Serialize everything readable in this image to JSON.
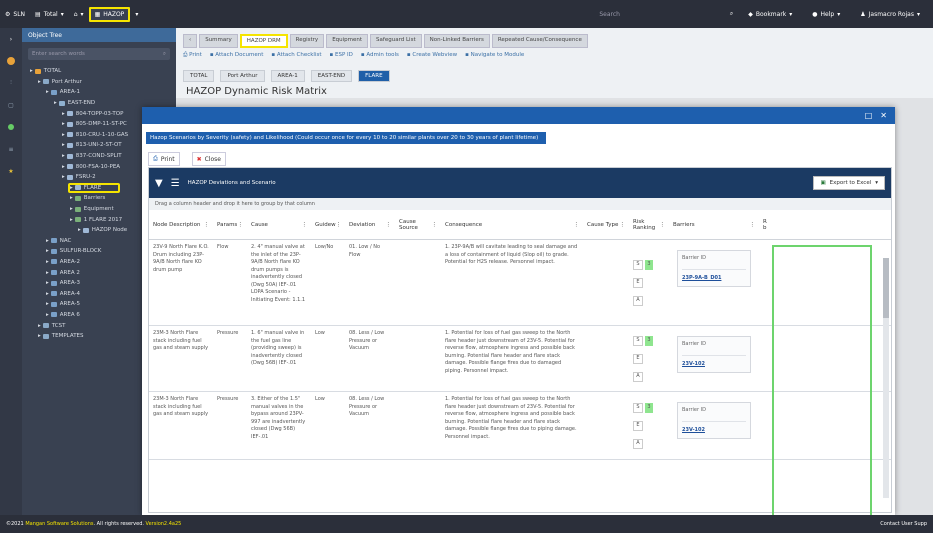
{
  "topnav": {
    "sln": "SLN",
    "total": "Total",
    "hazop": "HAZOP",
    "search": "Search",
    "bookmark": "Bookmark",
    "help": "Help",
    "user": "Jasmacro Rojas"
  },
  "tree": {
    "title": "Object Tree",
    "search_placeholder": "Enter search words",
    "nodes": [
      {
        "label": "TOTAL",
        "indent": 1
      },
      {
        "label": "Port Arthur",
        "indent": 2
      },
      {
        "label": "AREA-1",
        "indent": 3
      },
      {
        "label": "EAST-END",
        "indent": 4
      },
      {
        "label": "804-TOPP-03-TOP",
        "indent": 5
      },
      {
        "label": "805-DMP-11-ST-PC",
        "indent": 5
      },
      {
        "label": "810-CRU-1-10-GAS",
        "indent": 5
      },
      {
        "label": "813-UNI-2-ST-OT",
        "indent": 5
      },
      {
        "label": "837-COND-SPLIT",
        "indent": 5
      },
      {
        "label": "800-FSA-10-PEA",
        "indent": 5
      },
      {
        "label": "FSRU-2",
        "indent": 5
      },
      {
        "label": "FLARE",
        "indent": 5,
        "highlight": true
      },
      {
        "label": "Barriers",
        "indent": 6
      },
      {
        "label": "Equipment",
        "indent": 6
      },
      {
        "label": "1 FLARE 2017",
        "indent": 6
      },
      {
        "label": "HAZOP Node",
        "indent": 7
      },
      {
        "label": "NAC",
        "indent": 3
      },
      {
        "label": "SULFUR-BLOCK",
        "indent": 3
      },
      {
        "label": "AREA-2",
        "indent": 3
      },
      {
        "label": "AREA 2",
        "indent": 3
      },
      {
        "label": "AREA-3",
        "indent": 3
      },
      {
        "label": "AREA-4",
        "indent": 3
      },
      {
        "label": "AREA-5",
        "indent": 3
      },
      {
        "label": "AREA 6",
        "indent": 3
      },
      {
        "label": "TCST",
        "indent": 2
      },
      {
        "label": "TEMPLATES",
        "indent": 2
      }
    ]
  },
  "tabs": [
    "Summary",
    "HAZOP DRM",
    "Registry",
    "Equipment",
    "Safeguard List",
    "Non-Linked Barriers",
    "Repeated Cause/Consequence"
  ],
  "active_tab": "HAZOP DRM",
  "toolbar": [
    "Print",
    "Attach Document",
    "Attach Checklist",
    "ESP ID",
    "Admin tools",
    "Create Webview",
    "Navigate to Module"
  ],
  "breadcrumb": [
    "TOTAL",
    "Port Arthur",
    "AREA-1",
    "EAST-END",
    "FLARE"
  ],
  "page_title": "HAZOP Dynamic Risk Matrix",
  "modal": {
    "description": "Hazop Scenarios by Severity (safety) and Likelihood (Could occur once for every 10 to 20 similar plants over 20 to 30 years of plant lifetime)",
    "print": "Print",
    "close": "Close",
    "grid_title": "HAZOP Deviations and Scenario",
    "export": "Export to Excel",
    "group_hint": "Drag a column header and drop it here to group by that column",
    "columns": [
      "Node Description",
      "Params",
      "Cause",
      "Guidew",
      "Deviation",
      "Cause Source",
      "Consequence",
      "Cause Type",
      "Risk Ranking",
      "Barriers",
      "R b"
    ],
    "rows": [
      {
        "node": "23V-9 North Flare K.O. Drum including 23P-9A/B North flare KO drum pump",
        "param": "Flow",
        "cause": "2. 4\" manual valve at the inlet of the 23P-9A/B North flare KO drum pumps is inadvertently closed (Dwg 50A) IEF-.01 LOPA Scenario - Initiating Event: 1.1.1",
        "guideword": "Low/No",
        "deviation": "01. Low / No Flow",
        "consequence": "1. 23P-9A/B will cavitate leading to seal damage and a loss of containment of liquid (Slop oil) to grade. Potential for H2S release. Personnel impact.",
        "rank": {
          "s": "S",
          "sv": "3",
          "e": "E",
          "a": "A"
        },
        "barrier_label": "Barrier ID",
        "barrier": "23P-9A-B_D01"
      },
      {
        "node": "23M-3 North Flare stack including fuel gas and steam supply",
        "param": "Pressure",
        "cause": "1. 6\" manual valve in the fuel gas line (providing sweep) is inadvertently closed (Dwg 56B) IEF-.01",
        "guideword": "Low",
        "deviation": "08. Less / Low Pressure or Vacuum",
        "consequence": "1. Potential for loss of fuel gas sweep to the North flare header just downstream of 23V-5. Potential for reverse flow, atmosphere ingress and possible back burning. Potential flare header and flare stack damage. Possible flange fires due to damaged piping. Personnel impact.",
        "rank": {
          "s": "S",
          "sv": "3",
          "e": "E",
          "a": "A"
        },
        "barrier_label": "Barrier ID",
        "barrier": "23V-102"
      },
      {
        "node": "23M-3 North Flare stack including fuel gas and steam supply",
        "param": "Pressure",
        "cause": "3. Either of the 1.5\" manual valves in the bypass around 23PV-997 are inadvertently closed (Dwg 56B) IEF-.01",
        "guideword": "Low",
        "deviation": "08. Less / Low Pressure or Vacuum",
        "consequence": "1. Potential for loss of fuel gas sweep to the North flare header just downstream of 23V-5. Potential for reverse flow, atmosphere ingress and possible back burning. Potential flare header and flare stack damage. Possible flange fires due to piping damage. Personnel impact.",
        "rank": {
          "s": "S",
          "sv": "3",
          "e": "E",
          "a": "A"
        },
        "barrier_label": "Barrier ID",
        "barrier": "23V-102"
      }
    ]
  },
  "footer": {
    "copyright": "©2021",
    "company": "Mangan Software Solutions",
    "rights": ". All rights reserved.",
    "version": "Version2.4a25",
    "contact": "Contact User Supp"
  },
  "colors": {
    "highlight": "#f5e400",
    "accent": "#1e5fae",
    "barrier_outline": "#6dd46d"
  }
}
